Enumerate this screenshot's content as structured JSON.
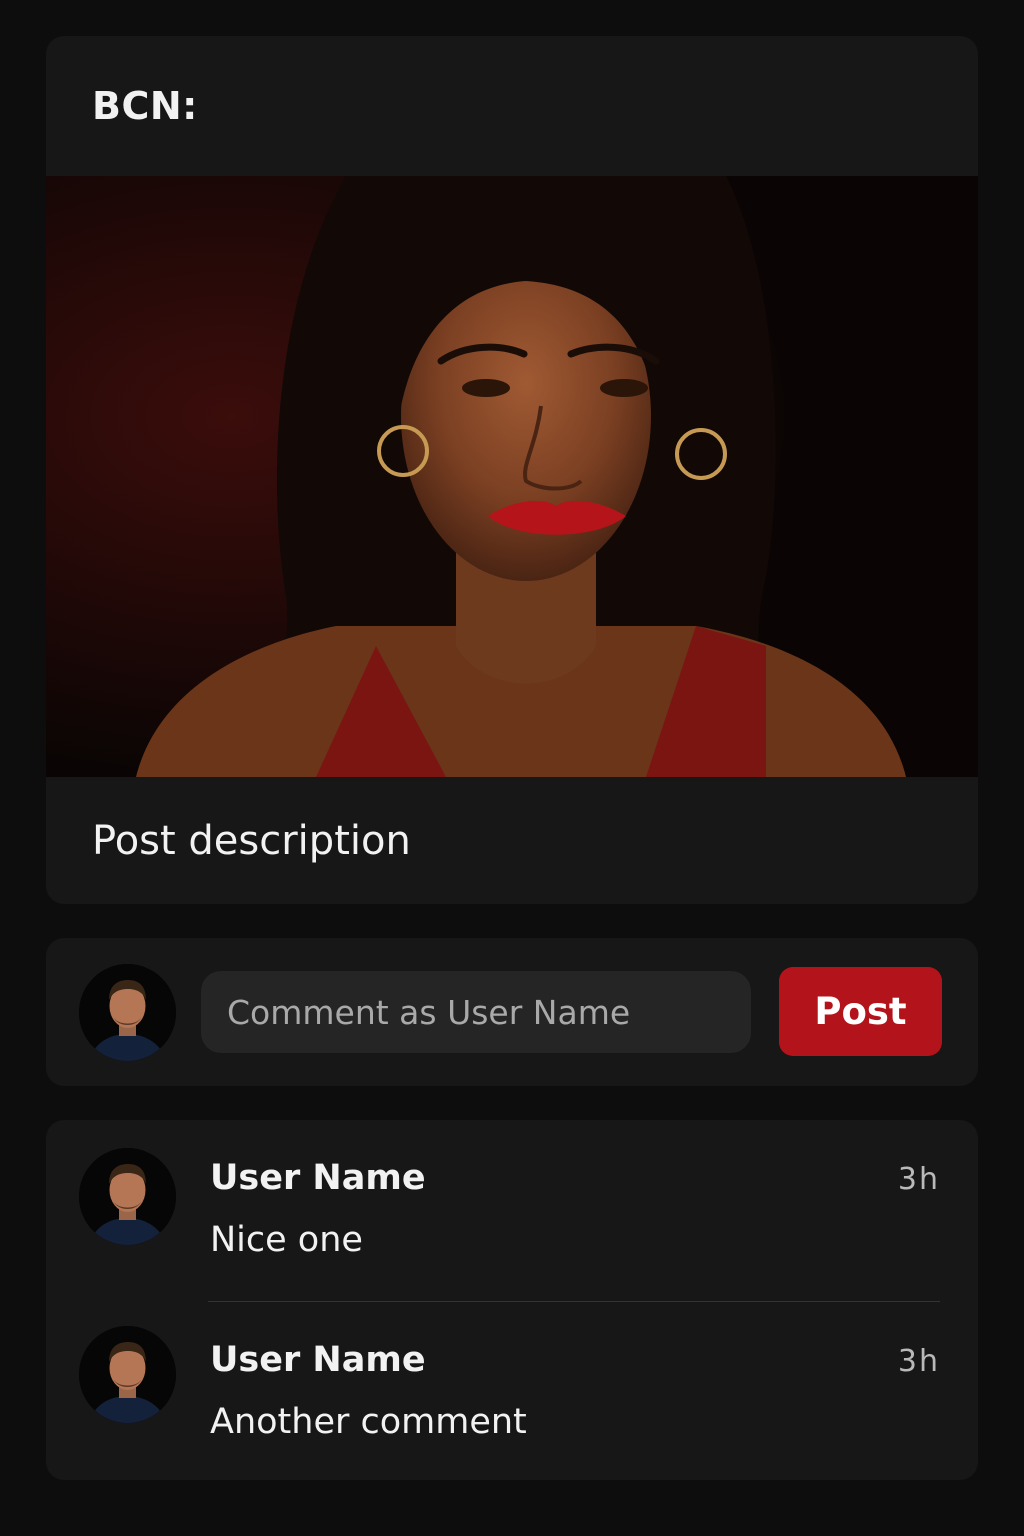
{
  "post": {
    "title": "BCN:",
    "description": "Post description"
  },
  "composer": {
    "placeholder": "Comment as User Name",
    "post_label": "Post"
  },
  "comments": [
    {
      "user": "User Name",
      "text": "Nice one",
      "time": "3h"
    },
    {
      "user": "User Name",
      "text": "Another comment",
      "time": "3h"
    }
  ],
  "colors": {
    "background": "#0d0d0d",
    "card": "#171717",
    "accent": "#b3141b"
  }
}
